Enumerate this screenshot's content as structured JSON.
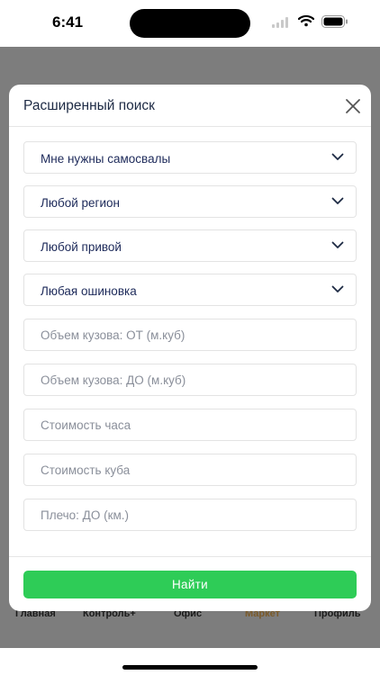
{
  "status_bar": {
    "time": "6:41"
  },
  "modal": {
    "title": "Расширенный поиск",
    "selects": [
      {
        "value": "Мне нужны самосвалы"
      },
      {
        "value": "Любой регион"
      },
      {
        "value": "Любой привой"
      },
      {
        "value": "Любая ошиновка"
      }
    ],
    "inputs": [
      {
        "placeholder": "Объем кузова: ОТ (м.куб)"
      },
      {
        "placeholder": "Объем кузова: ДО (м.куб)"
      },
      {
        "placeholder": "Стоимость часа"
      },
      {
        "placeholder": "Стоимость куба"
      },
      {
        "placeholder": "Плечо: ДО (км.)"
      }
    ],
    "submit_label": "Найти"
  },
  "tabbar": {
    "items": [
      {
        "label": "Главная"
      },
      {
        "label": "Контроль+"
      },
      {
        "label": "Офис"
      },
      {
        "label": "Маркет",
        "active": true
      },
      {
        "label": "Профиль"
      }
    ]
  },
  "colors": {
    "accent_green": "#2ecc57",
    "overlay": "#7d7d7d",
    "active_tab": "#7a5a2a",
    "field_text": "#1d2a5a"
  }
}
